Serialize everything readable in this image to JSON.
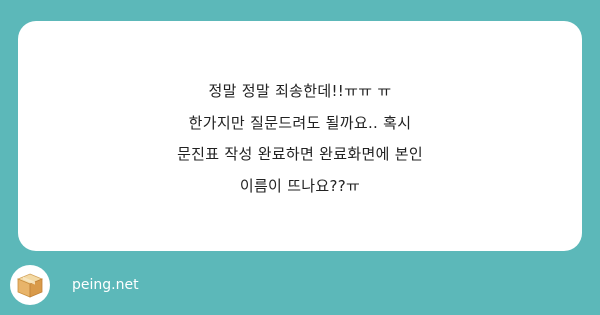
{
  "question": {
    "lines": [
      "정말 정말 죄송한데!!ㅠㅠ ㅠ",
      "한가지만 질문드려도 될까요.. 혹시",
      "문진표 작성 완료하면 완료화면에 본인",
      "이름이 뜨나요??ㅠ"
    ]
  },
  "footer": {
    "site_name": "peing.net",
    "logo_icon": "box-icon"
  },
  "colors": {
    "background": "#5cb8b9",
    "card": "#ffffff",
    "text": "#222222"
  }
}
